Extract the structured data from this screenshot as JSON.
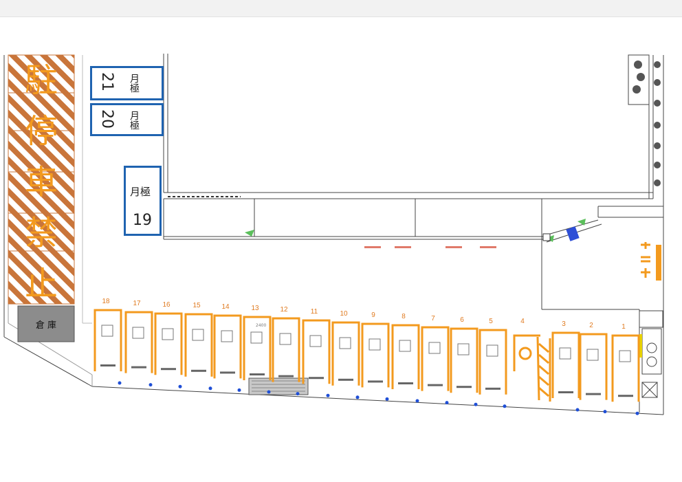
{
  "plan": {
    "no_parking_text": [
      "駐",
      "停",
      "車",
      "禁",
      "止"
    ],
    "storage_label": "倉 庫",
    "monthly_boxes": [
      {
        "number": "21",
        "label": "月極"
      },
      {
        "number": "20",
        "label": "月極"
      },
      {
        "number": "19",
        "label": "月極"
      }
    ],
    "space_numbers": [
      "18",
      "17",
      "16",
      "15",
      "14",
      "13",
      "12",
      "11",
      "10",
      "9",
      "8",
      "7",
      "6",
      "5",
      "4",
      "3",
      "2",
      "1"
    ],
    "small_dimension_label": "2400",
    "colors": {
      "accent_orange": "#f39a1e",
      "box_blue": "#1f63b0",
      "storage_gray": "#8c8c8c"
    }
  }
}
